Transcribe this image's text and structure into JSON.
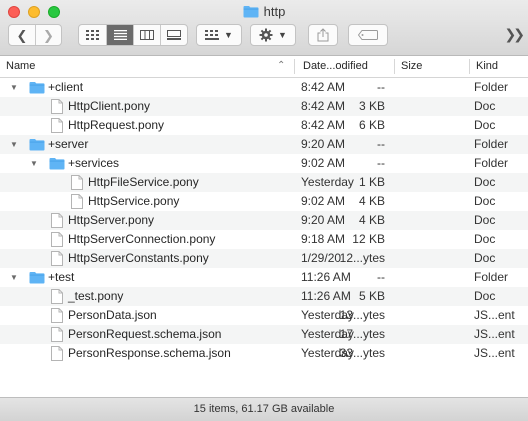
{
  "window": {
    "title": "http"
  },
  "columns": {
    "name": "Name",
    "date": "Date...odified",
    "size": "Size",
    "kind": "Kind"
  },
  "rows": [
    {
      "level": 0,
      "type": "folder",
      "expanded": true,
      "name": "+client",
      "date": "8:42 AM",
      "size": "--",
      "kind": "Folder"
    },
    {
      "level": 1,
      "type": "file",
      "name": "HttpClient.pony",
      "date": "8:42 AM",
      "size": "3 KB",
      "kind": "Doc"
    },
    {
      "level": 1,
      "type": "file",
      "name": "HttpRequest.pony",
      "date": "8:42 AM",
      "size": "6 KB",
      "kind": "Doc"
    },
    {
      "level": 0,
      "type": "folder",
      "expanded": true,
      "name": "+server",
      "date": "9:20 AM",
      "size": "--",
      "kind": "Folder"
    },
    {
      "level": 1,
      "type": "folder",
      "expanded": true,
      "name": "+services",
      "date": "9:02 AM",
      "size": "--",
      "kind": "Folder"
    },
    {
      "level": 2,
      "type": "file",
      "name": "HttpFileService.pony",
      "date": "Yesterday",
      "size": "1 KB",
      "kind": "Doc"
    },
    {
      "level": 2,
      "type": "file",
      "name": "HttpService.pony",
      "date": "9:02 AM",
      "size": "4 KB",
      "kind": "Doc"
    },
    {
      "level": 1,
      "type": "file",
      "name": "HttpServer.pony",
      "date": "9:20 AM",
      "size": "4 KB",
      "kind": "Doc"
    },
    {
      "level": 1,
      "type": "file",
      "name": "HttpServerConnection.pony",
      "date": "9:18 AM",
      "size": "12 KB",
      "kind": "Doc"
    },
    {
      "level": 1,
      "type": "file",
      "name": "HttpServerConstants.pony",
      "date": "1/29/20",
      "size": "12...ytes",
      "kind": "Doc"
    },
    {
      "level": 0,
      "type": "folder",
      "expanded": true,
      "name": "+test",
      "date": "11:26 AM",
      "size": "--",
      "kind": "Folder"
    },
    {
      "level": 1,
      "type": "file",
      "name": "_test.pony",
      "date": "11:26 AM",
      "size": "5 KB",
      "kind": "Doc"
    },
    {
      "level": 1,
      "type": "file",
      "name": "PersonData.json",
      "date": "Yesterday",
      "size": "13...ytes",
      "kind": "JS...ent"
    },
    {
      "level": 1,
      "type": "file",
      "name": "PersonRequest.schema.json",
      "date": "Yesterday",
      "size": "17...ytes",
      "kind": "JS...ent"
    },
    {
      "level": 1,
      "type": "file",
      "name": "PersonResponse.schema.json",
      "date": "Yesterday",
      "size": "33...ytes",
      "kind": "JS...ent"
    }
  ],
  "status": {
    "text": "15 items, 61.17 GB available"
  },
  "colors": {
    "folder": "#5fb4f5",
    "folder_tab": "#4aa3ea",
    "active_view": "#6b6b6b"
  }
}
